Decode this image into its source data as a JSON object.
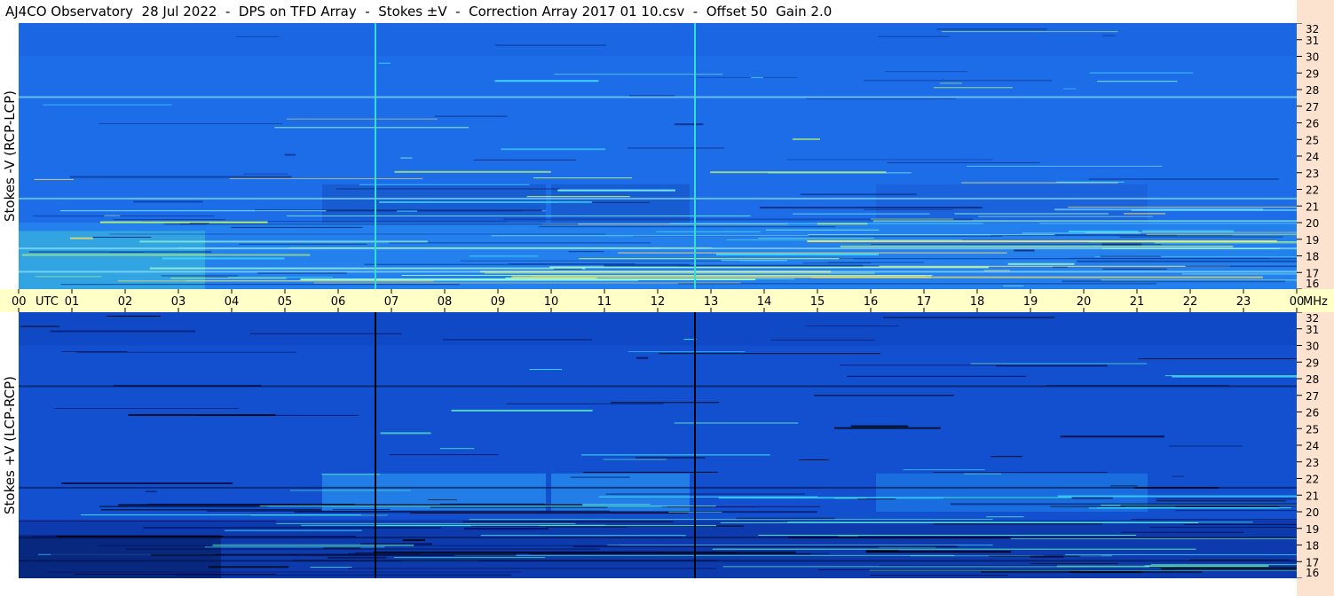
{
  "header": {
    "title": "AJ4CO Observatory  28 Jul 2022  -  DPS on TFD Array  -  Stokes ±V  -  Correction Array 2017 01 10.csv  -  Offset 50  Gain 2.0"
  },
  "colors": {
    "panel_top_base": "#1d6de8",
    "panel_bottom_base": "#1350d0",
    "freq_axis_bg": "#fce3d0",
    "time_axis_bg": "#ffffc8"
  },
  "chart_data": [
    {
      "type": "heatmap",
      "name": "Stokes -V (RCP-LCP)",
      "ylabel": "Stokes -V (RCP-LCP)",
      "x": {
        "unit": "UTC",
        "range": [
          0,
          24
        ]
      },
      "y": {
        "unit": "MHz",
        "range": [
          16,
          32
        ],
        "ticks": [
          "32",
          "31",
          "30",
          "29",
          "28",
          "27",
          "26",
          "25",
          "24",
          "23",
          "22",
          "21",
          "20",
          "19",
          "18",
          "17",
          "16"
        ]
      },
      "vertical_lines_utc": [
        6.7,
        12.7
      ],
      "vertical_line_color": "#30e0c8"
    },
    {
      "type": "heatmap",
      "name": "Stokes +V (LCP-RCP)",
      "ylabel": "Stokes +V (LCP-RCP)",
      "x": {
        "unit": "UTC",
        "range": [
          0,
          24
        ]
      },
      "y": {
        "unit": "MHz",
        "range": [
          16,
          32
        ],
        "ticks": [
          "32",
          "31",
          "30",
          "29",
          "28",
          "27",
          "26",
          "25",
          "24",
          "23",
          "22",
          "21",
          "20",
          "19",
          "18",
          "17",
          "16"
        ]
      },
      "vertical_lines_utc": [
        6.7,
        12.7
      ],
      "vertical_line_color": "#000000"
    }
  ],
  "time_axis": {
    "labels": [
      "00",
      "01",
      "02",
      "03",
      "04",
      "05",
      "06",
      "07",
      "08",
      "09",
      "10",
      "11",
      "12",
      "13",
      "14",
      "15",
      "16",
      "17",
      "18",
      "19",
      "20",
      "21",
      "22",
      "23",
      "00"
    ],
    "utc_label": "UTC",
    "unit_label": "MHz"
  }
}
